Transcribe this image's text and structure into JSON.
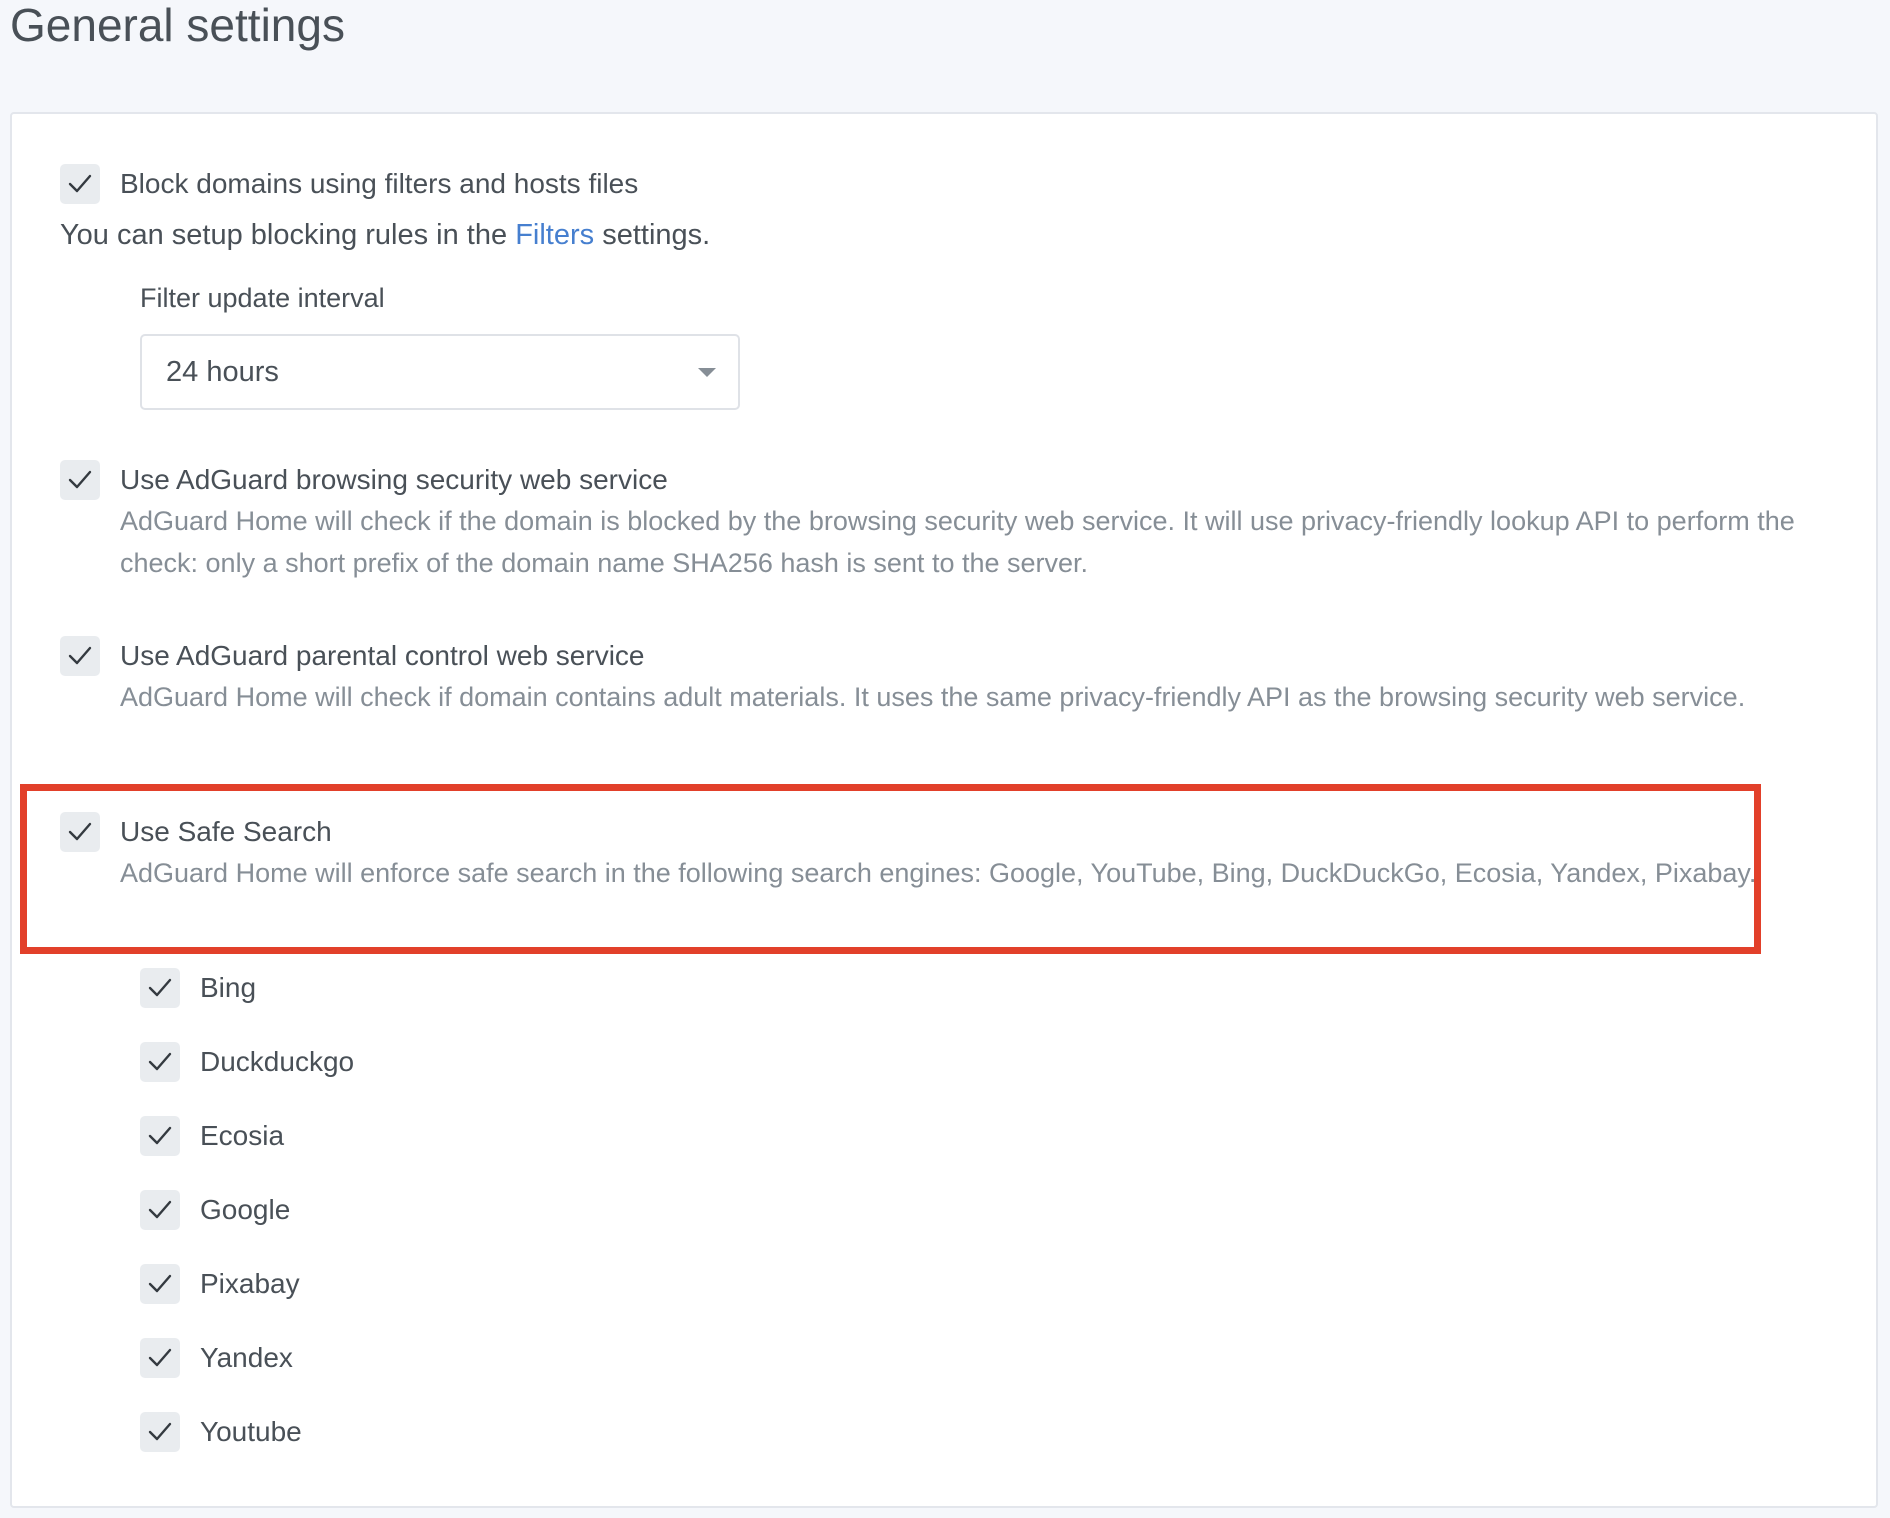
{
  "page": {
    "title": "General settings"
  },
  "block_filters": {
    "label": "Block domains using filters and hosts files",
    "checked": true,
    "info_prefix": "You can setup blocking rules in the",
    "info_link": "Filters",
    "info_suffix": "settings.",
    "interval_label": "Filter update interval",
    "interval_value": "24 hours"
  },
  "browsing_security": {
    "label": "Use AdGuard browsing security web service",
    "checked": true,
    "description": "AdGuard Home will check if the domain is blocked by the browsing security web service. It will use privacy-friendly lookup API to perform the check: only a short prefix of the domain name SHA256 hash is sent to the server."
  },
  "parental_control": {
    "label": "Use AdGuard parental control web service",
    "checked": true,
    "description": "AdGuard Home will check if domain contains adult materials. It uses the same privacy-friendly API as the browsing security web service."
  },
  "safe_search": {
    "label": "Use Safe Search",
    "checked": true,
    "description": "AdGuard Home will enforce safe search in the following search engines: Google, YouTube, Bing, DuckDuckGo, Ecosia, Yandex, Pixabay.",
    "engines": [
      {
        "label": "Bing",
        "checked": true
      },
      {
        "label": "Duckduckgo",
        "checked": true
      },
      {
        "label": "Ecosia",
        "checked": true
      },
      {
        "label": "Google",
        "checked": true
      },
      {
        "label": "Pixabay",
        "checked": true
      },
      {
        "label": "Yandex",
        "checked": true
      },
      {
        "label": "Youtube",
        "checked": true
      }
    ]
  },
  "colors": {
    "highlight": "#e2402a",
    "link": "#467fcf",
    "checkbox_bg": "#e9ecef"
  },
  "icons": {
    "checkbox": "checkmark-icon",
    "select": "caret-down-icon"
  }
}
